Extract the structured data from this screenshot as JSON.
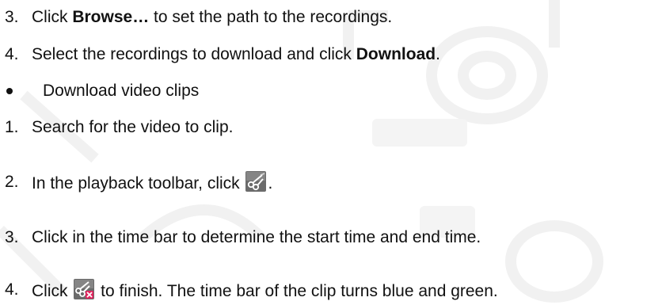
{
  "steps": [
    {
      "num": "3.",
      "pre": "Click ",
      "bold": "Browse…",
      "post": " to set the path to the recordings."
    },
    {
      "num": "4.",
      "pre": "Select the recordings to download and click ",
      "bold": "Download",
      "post": "."
    },
    {
      "bullet_text": "Download video clips"
    },
    {
      "num": "1.",
      "text": "Search for the video to clip."
    },
    {
      "num": "2.",
      "pre": "In the playback toolbar, click ",
      "post": ".",
      "icon": "scissors-clip-icon"
    },
    {
      "num": "3.",
      "text": "Click in the time bar to determine the start time and end time."
    },
    {
      "num": "4.",
      "pre": "Click ",
      "post": " to finish. The time bar of the clip turns blue and green.",
      "icon": "scissors-finish-icon"
    }
  ]
}
